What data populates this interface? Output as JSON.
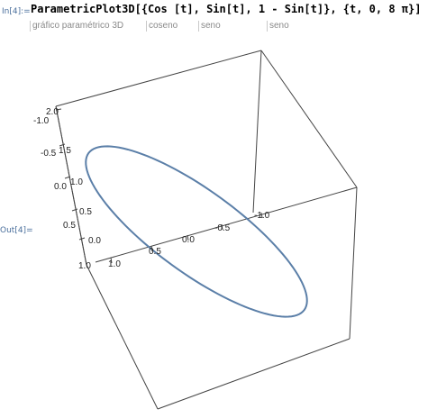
{
  "input": {
    "label": "In[4]:=",
    "code": "ParametricPlot3D[{Cos [t], Sin[t], 1 - Sin[t]}, {t, 0, 8 π}]"
  },
  "hints": [
    "gráfico paramétrico 3D",
    "coseno",
    "seno",
    "seno"
  ],
  "output": {
    "label": "Out[4]="
  },
  "plot": {
    "curve_color": "#5b7fa8",
    "box_color": "#444444",
    "z_axis_ticks": [
      "2.0",
      "1.5",
      "1.0",
      "0.5",
      "0.0"
    ],
    "y_axis_ticks": [
      "-1.0",
      "-0.5",
      "0.0",
      "0.5",
      "1.0"
    ],
    "x_axis_ticks": [
      "1.0",
      "0.5",
      "0.0",
      "-0.5",
      "-1.0"
    ]
  }
}
